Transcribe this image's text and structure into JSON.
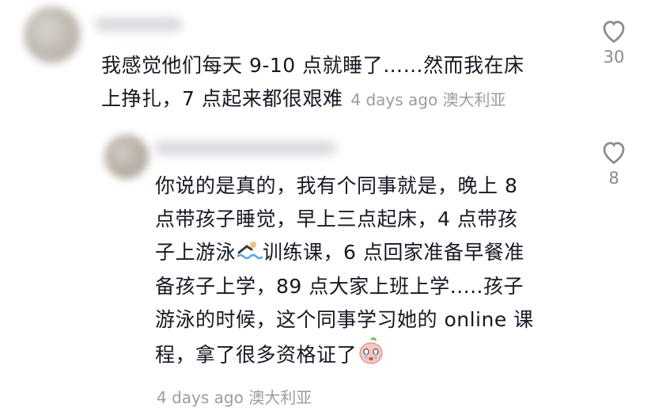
{
  "comments": [
    {
      "text_line1": "我感觉他们每天 9-10 点就睡了……然而我在床",
      "text_line2": "上挣扎，7 点起来都很艰难",
      "meta": "4 days ago 澳大利亚",
      "like_count": "30",
      "like_icon": "heart-outline-icon"
    },
    {
      "line1": "你说的是真的，我有个同事就是，晚上 8",
      "line2": "点带孩子睡觉，早上三点起床，4 点带孩",
      "line3a": "子上游泳",
      "line3b": "训练课，6 点回家准备早餐准",
      "line4": "备孩子上学，89 点大家上班上学.....孩子",
      "line5": "游泳的时候，这个同事学习她的 online 课",
      "line6": "程，拿了很多资格证了",
      "meta": "4 days ago 澳大利亚",
      "like_count": "8",
      "like_icon": "heart-outline-icon",
      "emoji_swim": "swimmer-emoji-icon",
      "emoji_face": "crying-face-emoji-icon"
    }
  ]
}
